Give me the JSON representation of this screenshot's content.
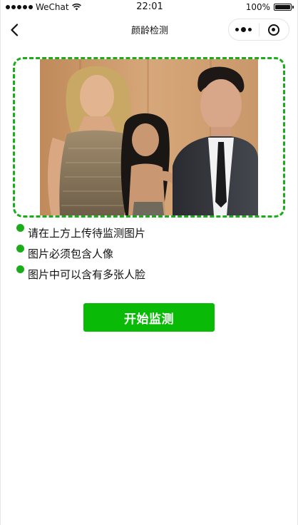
{
  "status_bar": {
    "carrier": "WeChat",
    "time": "22:01",
    "battery": "100%"
  },
  "nav": {
    "title": "颜龄检测",
    "back_icon": "chevron-left-icon",
    "more_icon": "more-dots-icon",
    "close_icon": "target-circle-icon"
  },
  "upload": {
    "image_description": "photo-of-three-people"
  },
  "tips": [
    {
      "text": "请在上方上传待监测图片"
    },
    {
      "text": "图片必须包含人像"
    },
    {
      "text": "图片中可以含有多张人脸"
    }
  ],
  "actions": {
    "start_label": "开始监测"
  },
  "colors": {
    "accent": "#1aad19",
    "button": "#09bb07",
    "text": "#111111"
  }
}
